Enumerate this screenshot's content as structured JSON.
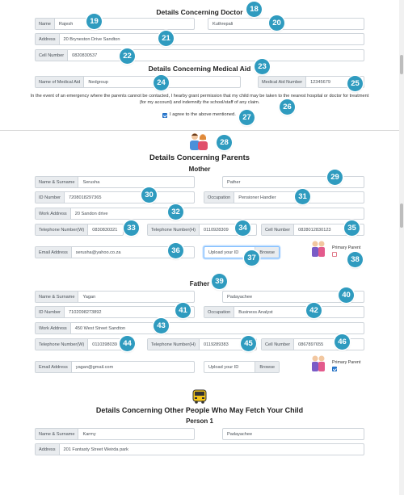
{
  "doctor": {
    "heading": "Details Concerning Doctor",
    "name_label": "Name",
    "name_first": "Rajesh",
    "name_last": "Kuthrepali",
    "address_label": "Address",
    "address": "20 Bryneston Drive Sandton",
    "cell_label": "Cell Number",
    "cell": "0820830537"
  },
  "medical_aid": {
    "heading": "Details Concerning Medical Aid",
    "name_label": "Name of Medical Aid",
    "name": "Nedgroup",
    "number_label": "Medical Aid Number",
    "number": "12345679",
    "consent_text": "In the event of an emergency where the parents cannot be contacted, I hearby grant permission that my child may be taken to the nearest hospital or doctor for treatment (for my account) and indemnify the school/staff of any claim.",
    "agree_label": "I agree to the above mentioned."
  },
  "parents": {
    "heading": "Details Concerning Parents",
    "mother": {
      "heading": "Mother",
      "name_label": "Name & Surname",
      "first_name": "Serusha",
      "surname": "Pather",
      "id_label": "ID Number",
      "id": "7208018297365",
      "occupation_label": "Occupation",
      "occupation": "Pensioner Handler",
      "work_label": "Work Address",
      "work_address": "20 Sandon drive",
      "tel_w_label": "Telephone Number(W)",
      "tel_w": "0830830321",
      "tel_h_label": "Telephone Number(H)",
      "tel_h": "0110928309",
      "cell_label": "Cell Number",
      "cell": "0828012830123",
      "email_label": "Email Address",
      "email": "serusha@yahoo.co.za",
      "upload_placeholder": "Upload your ID",
      "browse_label": "Browse",
      "primary_label": "Primary Parent"
    },
    "father": {
      "heading": "Father",
      "name_label": "Name & Surname",
      "first_name": "Yagan",
      "surname": "Padayachee",
      "id_label": "ID Number",
      "id": "7102098273892",
      "occupation_label": "Occupation",
      "occupation": "Business Analyst",
      "work_label": "Work Address",
      "work_address": "450 West Street Sandton",
      "tel_w_label": "Telephone Number(W)",
      "tel_w": "0110398039",
      "tel_h_label": "Telephone Number(H)",
      "tel_h": "0119289383",
      "cell_label": "Cell Number",
      "cell": "0867897655",
      "email_label": "Email Address",
      "email": "yagan@gmail.com",
      "upload_placeholder": "Upload your ID",
      "browse_label": "Browse",
      "primary_label": "Primary Parent"
    }
  },
  "others": {
    "heading": "Details Concerning Other People Who May Fetch Your Child",
    "person1": {
      "heading": "Person 1",
      "name_label": "Name & Surname",
      "first_name": "Karmy",
      "surname": "Padayachee",
      "address_label": "Address",
      "address": "201 Fantasty Street Weirda park"
    }
  },
  "markers": [
    "18",
    "19",
    "20",
    "21",
    "22",
    "23",
    "24",
    "25",
    "26",
    "27",
    "28",
    "29",
    "30",
    "31",
    "32",
    "33",
    "34",
    "35",
    "36",
    "37",
    "38",
    "39",
    "40",
    "41",
    "42",
    "43",
    "44",
    "45",
    "46"
  ],
  "colors": {
    "marker": "#2f9bbf",
    "checkbox_on": "#2f7fd6"
  }
}
